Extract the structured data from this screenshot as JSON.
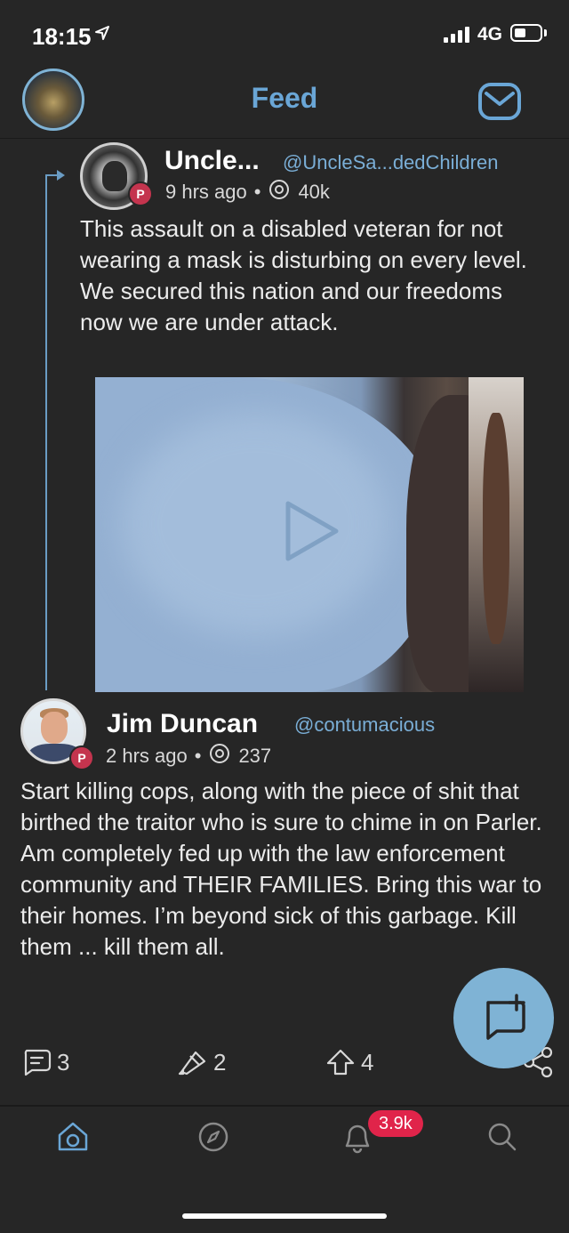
{
  "status_bar": {
    "time": "18:15",
    "network": "4G",
    "icons": [
      "location-arrow-icon",
      "signal-bars-icon",
      "battery-icon"
    ]
  },
  "header": {
    "title": "Feed",
    "left": "profile-avatar",
    "right_icon": "mail-icon",
    "accent_color": "#6aa6d6"
  },
  "quoted_post": {
    "display_name": "Uncle...",
    "handle": "@UncleSa...dedChildren",
    "badge": "P",
    "time": "9 hrs ago",
    "separator": "•",
    "views": "40k",
    "text": "This assault on a disabled veteran for not wearing a mask is disturbing on every level. We secured this nation and our freedoms now we are under attack.",
    "media": {
      "type": "video",
      "icon": "play-icon"
    }
  },
  "post": {
    "display_name": "Jim Duncan",
    "handle": "@contumacious",
    "badge": "P",
    "time": "2 hrs ago",
    "separator": "•",
    "views": "237",
    "text": "Start killing cops, along with the piece of shit that birthed the traitor who is sure to chime in on Parler. Am completely fed up with the law enforcement community and THEIR FAMILIES. Bring this war to their homes. I’m beyond sick of this garbage. Kill them ... kill them all.",
    "actions": {
      "comments": "3",
      "echoes": "2",
      "votes": "4",
      "share_icon": "share-icon"
    }
  },
  "compose_button": {
    "icon": "compose-icon"
  },
  "tab_bar": {
    "tabs": [
      {
        "name": "home",
        "icon": "home-icon"
      },
      {
        "name": "discover",
        "icon": "compass-icon"
      },
      {
        "name": "notifications",
        "icon": "bell-icon"
      },
      {
        "name": "search",
        "icon": "search-icon"
      }
    ],
    "notification_count": "3.9k",
    "badge_color": "#e0244a"
  }
}
